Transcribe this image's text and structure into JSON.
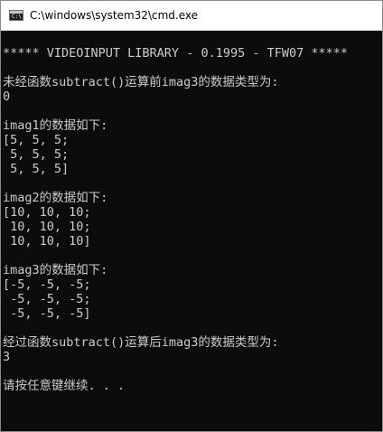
{
  "window": {
    "title": "C:\\windows\\system32\\cmd.exe",
    "icon": "console-window-icon",
    "icon_prompt": "C:\\"
  },
  "console": {
    "lines": [
      "***** VIDEOINPUT LIBRARY - 0.1995 - TFW07 *****",
      "",
      "未经函数subtract()运算前imag3的数据类型为:",
      "0",
      "",
      "imag1的数据如下:",
      "[5, 5, 5;",
      " 5, 5, 5;",
      " 5, 5, 5]",
      "",
      "imag2的数据如下:",
      "[10, 10, 10;",
      " 10, 10, 10;",
      " 10, 10, 10]",
      "",
      "imag3的数据如下:",
      "[-5, -5, -5;",
      " -5, -5, -5;",
      " -5, -5, -5]",
      "",
      "经过函数subtract()运算后imag3的数据类型为:",
      "3",
      "",
      "请按任意键继续. . ."
    ]
  },
  "colors": {
    "console_bg": "#0c0c0c",
    "console_text": "#cccccc",
    "titlebar_bg": "#ffffff"
  }
}
